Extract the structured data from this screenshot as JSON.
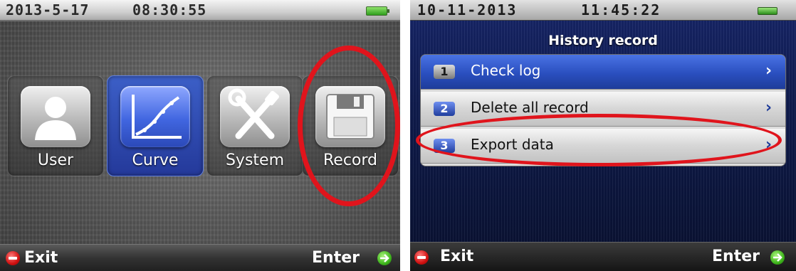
{
  "left_screen": {
    "status": {
      "date": "2013-5-17",
      "time": "08:30:55"
    },
    "menu": [
      {
        "label": "User",
        "icon": "user-icon",
        "selected": false
      },
      {
        "label": "Curve",
        "icon": "curve-chart-icon",
        "selected": true
      },
      {
        "label": "System",
        "icon": "tools-icon",
        "selected": false
      },
      {
        "label": "Record",
        "icon": "floppy-disk-icon",
        "selected": false
      }
    ],
    "bottom": {
      "exit_label": "Exit",
      "enter_label": "Enter"
    }
  },
  "right_screen": {
    "status": {
      "date": "10-11-2013",
      "time": "11:45:22"
    },
    "title": "History record",
    "items": [
      {
        "num": "1",
        "label": "Check log",
        "selected": true
      },
      {
        "num": "2",
        "label": "Delete all record",
        "selected": false
      },
      {
        "num": "3",
        "label": "Export data",
        "selected": false
      }
    ],
    "bottom": {
      "exit_label": "Exit",
      "enter_label": "Enter"
    }
  },
  "colors": {
    "annotation_red": "#e0141c",
    "selection_blue": "#2a4fbf",
    "exit_red": "#d11212",
    "enter_green": "#3fb51d"
  }
}
